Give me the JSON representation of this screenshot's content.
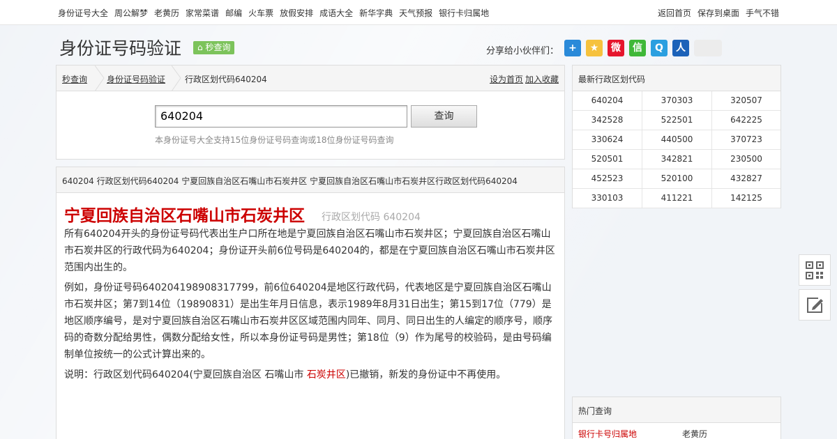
{
  "topnav": {
    "left": [
      "身份证号大全",
      "周公解梦",
      "老黄历",
      "家常菜谱",
      "邮编",
      "火车票",
      "放假安排",
      "成语大全",
      "新华字典",
      "天气预报",
      "银行卡归属地"
    ],
    "right": [
      "返回首页",
      "保存到桌面",
      "手气不错"
    ]
  },
  "header": {
    "title": "身份证号码验证",
    "badge": "秒查询",
    "share_label": "分享给小伙伴们：",
    "share_icons": [
      {
        "name": "add-icon",
        "color": "#2a8ad9",
        "glyph": "+"
      },
      {
        "name": "qzone-icon",
        "color": "#f6c23e",
        "glyph": "★"
      },
      {
        "name": "weibo-icon",
        "color": "#e6162d",
        "glyph": "微"
      },
      {
        "name": "wechat-icon",
        "color": "#3fb838",
        "glyph": "信"
      },
      {
        "name": "tencent-weibo-icon",
        "color": "#2b9fe0",
        "glyph": "Q"
      },
      {
        "name": "renren-icon",
        "color": "#1c62b9",
        "glyph": "人"
      }
    ]
  },
  "breadcrumb": {
    "items": [
      "秒查询",
      "身份证号码验证",
      "行政区划代码640204"
    ],
    "links": [
      "设为首页",
      "加入收藏"
    ]
  },
  "search": {
    "value": "640204",
    "button": "查询",
    "hint": "本身份证号大全支持15位身份证号码查询或18位身份证号码查询"
  },
  "content": {
    "header": "640204 行政区划代码640204 宁夏回族自治区石嘴山市石炭井区 宁夏回族自治区石嘴山市石炭井区行政区划代码640204",
    "title": "宁夏回族自治区石嘴山市石炭井区",
    "subtitle": "行政区划代码 640204",
    "p1": "所有640204开头的身份证号码代表出生户口所在地是宁夏回族自治区石嘴山市石炭井区；宁夏回族自治区石嘴山市石炭井区的行政代码为640204；身份证开头前6位号码是640204的，都是在宁夏回族自治区石嘴山市石炭井区范围内出生的。",
    "p2": "例如，身份证号码640204198908317799，前6位640204是地区行政代码，代表地区是宁夏回族自治区石嘴山市石炭井区；第7到14位（19890831）是出生年月日信息，表示1989年8月31日出生；第15到17位（779）是地区顺序编号，是对宁夏回族自治区石嘴山市石炭井区区域范围内同年、同月、同日出生的人编定的顺序号，顺序码的奇数分配给男性，偶数分配给女性，所以本身份证号码是男性；第18位（9）作为尾号的校验码，是由号码编制单位按统一的公式计算出来的。",
    "p3_prefix": "说明：行政区划代码640204(宁夏回族自治区 石嘴山市 ",
    "p3_link": "石炭井区",
    "p3_suffix": ")已撤销，新发的身份证中不再使用。"
  },
  "sidebar": {
    "latest_title": "最新行政区划代码",
    "codes": [
      "640204",
      "370303",
      "320507",
      "342528",
      "522501",
      "642225",
      "330624",
      "440500",
      "370723",
      "520501",
      "342821",
      "230500",
      "452523",
      "520100",
      "432827",
      "330103",
      "411221",
      "142125"
    ],
    "hot_title": "热门查询",
    "hot_items": [
      "银行卡号归属地",
      "老黄历"
    ]
  },
  "colors": {
    "accent": "#cc0000",
    "badge": "#7cc35b"
  }
}
